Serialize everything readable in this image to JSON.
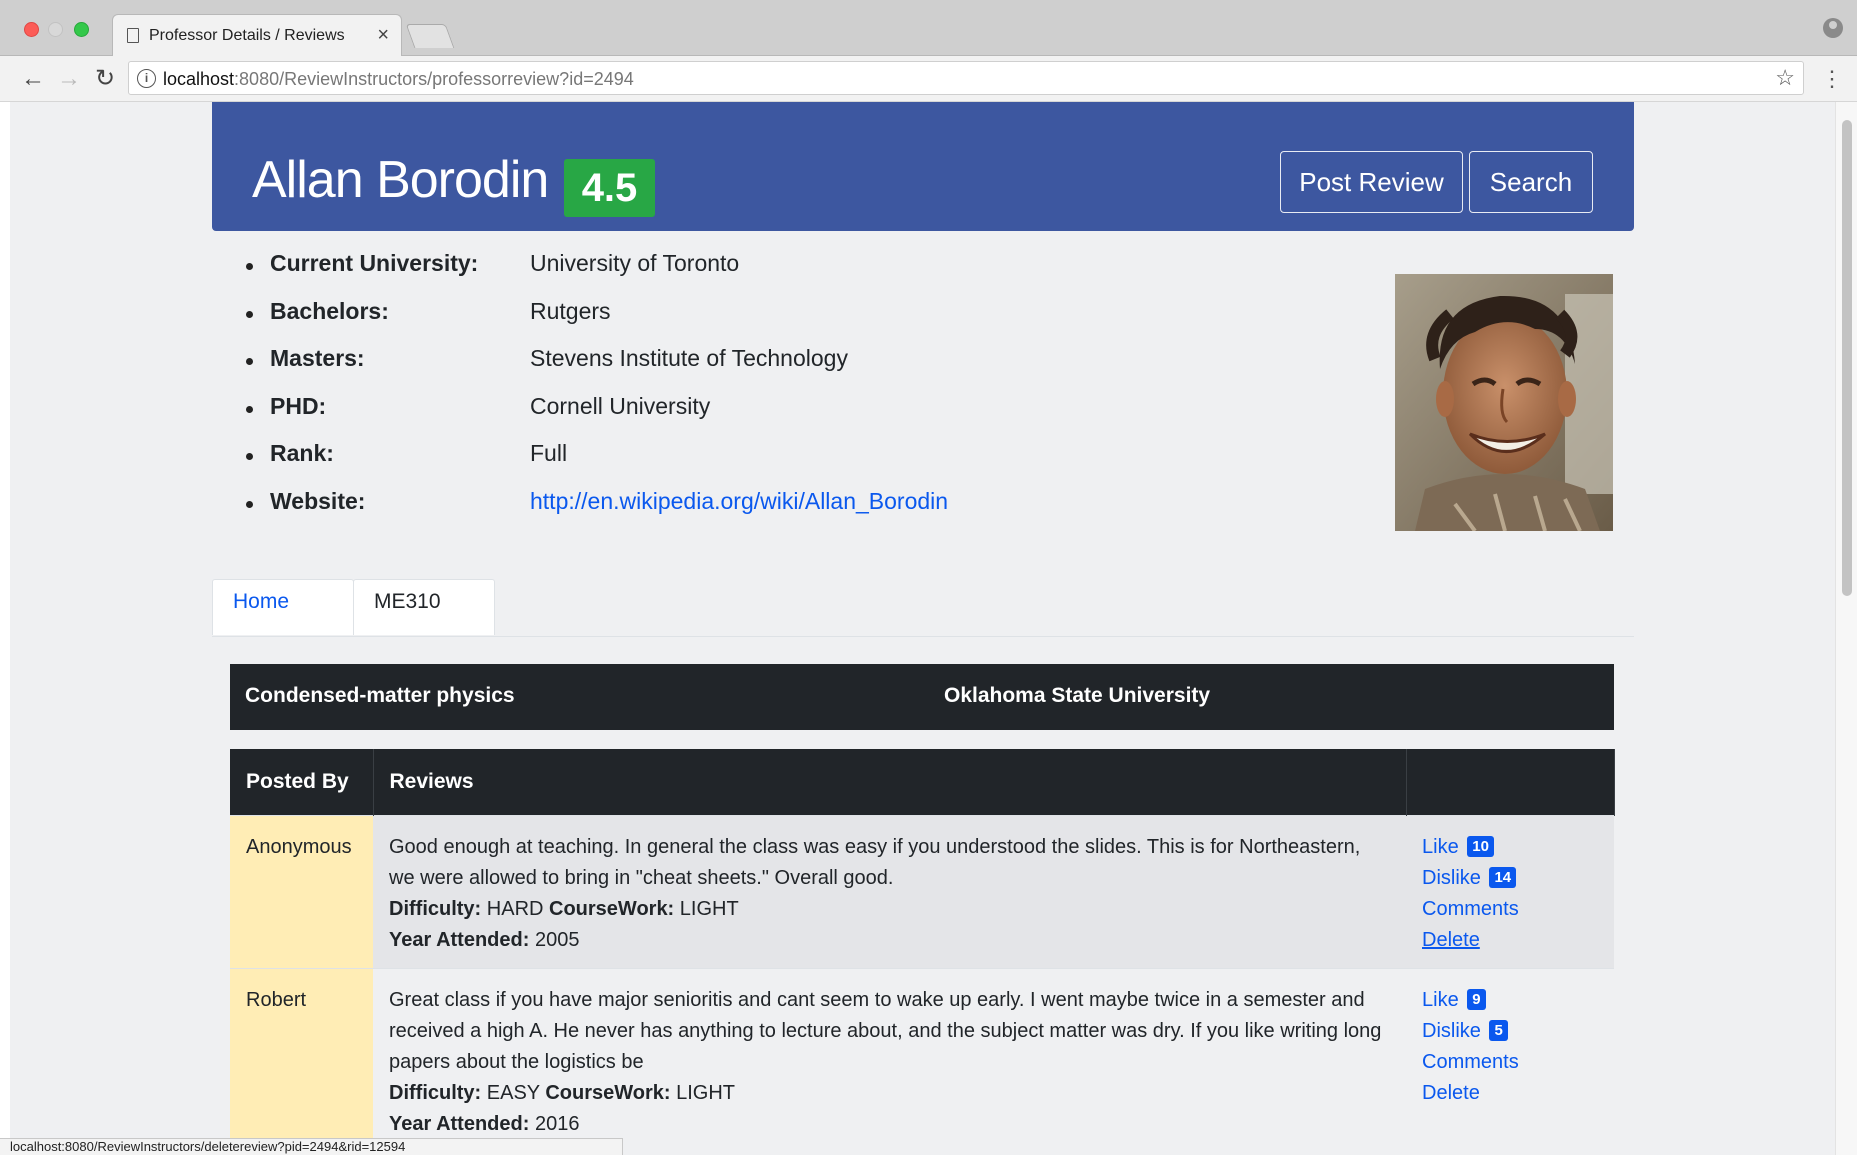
{
  "browser": {
    "tab_title": "Professor Details / Reviews",
    "tab_close": "×",
    "url_host": "localhost",
    "url_rest": ":8080/ReviewInstructors/professorreview?id=2494",
    "status_url": "localhost:8080/ReviewInstructors/deletereview?pid=2494&rid=12594",
    "icons": {
      "back": "back-arrow-icon",
      "forward": "forward-arrow-icon",
      "reload": "reload-icon",
      "info": "info-icon",
      "bookmark": "star-icon",
      "menu": "kebab-menu-icon",
      "profile": "profile-icon"
    }
  },
  "header": {
    "name": "Allan Borodin",
    "rating": "4.5",
    "post_review_label": "Post Review",
    "search_label": "Search",
    "colors": {
      "bar": "#3d57a0",
      "rating_badge": "#28a745"
    }
  },
  "details": [
    {
      "label": "Current University:",
      "value": "University of Toronto"
    },
    {
      "label": "Bachelors:",
      "value": "Rutgers"
    },
    {
      "label": "Masters:",
      "value": "Stevens Institute of Technology"
    },
    {
      "label": "PHD:",
      "value": "Cornell University"
    },
    {
      "label": "Rank:",
      "value": "Full"
    },
    {
      "label": "Website:",
      "value": "http://en.wikipedia.org/wiki/Allan_Borodin"
    }
  ],
  "tabs": [
    {
      "label": "Home"
    },
    {
      "label": "ME310"
    }
  ],
  "course": {
    "field": "Condensed-matter physics",
    "university": "Oklahoma State University"
  },
  "reviews_table": {
    "headers": [
      "Posted By",
      "Reviews",
      ""
    ],
    "difficulty_label": "Difficulty:",
    "coursework_label": "CourseWork:",
    "year_label": "Year Attended:",
    "like_label": "Like",
    "dislike_label": "Dislike",
    "comments_label": "Comments",
    "delete_label": "Delete",
    "rows": [
      {
        "posted_by": "Anonymous",
        "text": "Good enough at teaching. In general the class was easy if you understood the slides. This is for Northeastern, we were allowed to bring in \"cheat sheets.\" Overall good.",
        "difficulty": "HARD",
        "coursework": "LIGHT",
        "year": "2005",
        "likes": "10",
        "dislikes": "14"
      },
      {
        "posted_by": "Robert",
        "text": "Great class if you have major senioritis and cant seem to wake up early. I went maybe twice in a semester and received a high A. He never has anything to lecture about, and the subject matter was dry. If you like writing long papers about the logistics be",
        "difficulty": "EASY",
        "coursework": "LIGHT",
        "year": "2016",
        "likes": "9",
        "dislikes": "5"
      }
    ]
  }
}
